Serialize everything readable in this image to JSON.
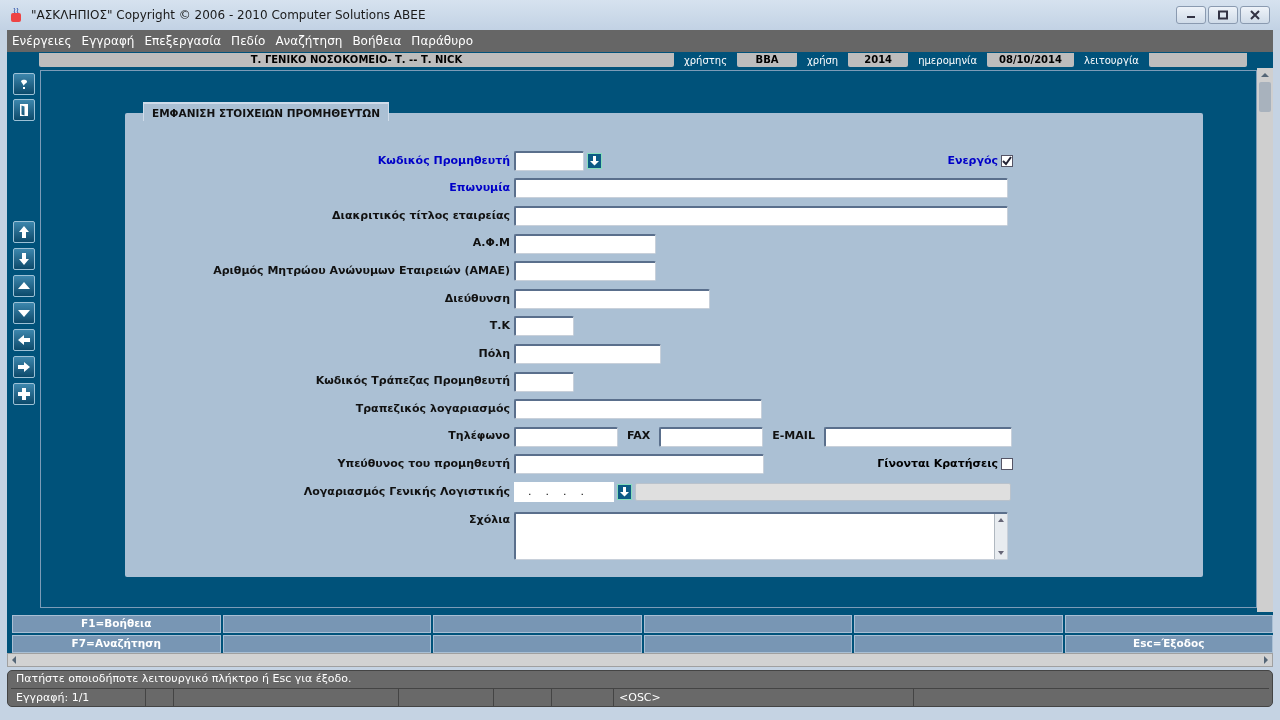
{
  "window": {
    "title": "\"ΑΣΚΛΗΠΙΟΣ\" Copyright © 2006 - 2010 Computer Solutions ABEE"
  },
  "menu": [
    "Ενέργειες",
    "Εγγραφή",
    "Επεξεργασία",
    "Πεδίο",
    "Αναζήτηση",
    "Βοήθεια",
    "Παράθυρο"
  ],
  "header": {
    "organization": "Τ. ΓΕΝΙΚΟ ΝΟΣΟΚΟΜΕΙΟ- Τ. -- Τ. ΝΙCK",
    "items": [
      {
        "label": "χρήστης",
        "value": "BBA"
      },
      {
        "label": "χρήση",
        "value": "2014"
      },
      {
        "label": "ημερομηνία",
        "value": "08/10/2014"
      },
      {
        "label": "λειτουργία"
      }
    ]
  },
  "form": {
    "title": "ΕΜΦΑΝΙΣΗ ΣΤΟΙΧΕΙΩΝ ΠΡΟΜΗΘΕΥΤΩΝ",
    "rows": [
      {
        "label": "Κωδικός Προμηθευτή",
        "required": true,
        "fields": [
          {
            "kind": "lookup"
          }
        ],
        "aside": {
          "label": "Ενεργός",
          "required": true,
          "checked": true
        }
      },
      {
        "label": "Επωνυμία",
        "required": true,
        "fields": [
          {
            "kind": "text"
          }
        ]
      },
      {
        "label": "Διακριτικός τίτλος εταιρείας",
        "required": false,
        "fields": [
          {
            "kind": "text"
          }
        ]
      },
      {
        "label": "Α.Φ.Μ",
        "required": false,
        "fields": [
          {
            "kind": "text"
          }
        ]
      },
      {
        "label": "Αριθμός Μητρώου Ανώνυμων Εταιρειών (ΑΜΑΕ)",
        "required": false,
        "fields": [
          {
            "kind": "text"
          }
        ]
      },
      {
        "label": "Διεύθυνση",
        "required": false,
        "fields": [
          {
            "kind": "text"
          }
        ]
      },
      {
        "label": "Τ.Κ",
        "required": false,
        "fields": [
          {
            "kind": "text"
          }
        ]
      },
      {
        "label": "Πόλη",
        "required": false,
        "fields": [
          {
            "kind": "text"
          }
        ]
      },
      {
        "label": "Κωδικός Τράπεζας Προμηθευτή",
        "required": false,
        "fields": [
          {
            "kind": "text"
          }
        ]
      },
      {
        "label": "Τραπεζικός λογαριασμός",
        "required": false,
        "fields": [
          {
            "kind": "text"
          }
        ]
      },
      {
        "label": "Τηλέφωνο",
        "required": false,
        "fields": [
          {
            "kind": "text"
          },
          {
            "kind": "text",
            "label": "FAX"
          },
          {
            "kind": "text",
            "label": "E-MAIL"
          }
        ]
      },
      {
        "label": "Υπεύθυνος του προμηθευτή",
        "required": false,
        "fields": [
          {
            "kind": "text"
          }
        ],
        "aside": {
          "label": "Γίνονται Κρατήσεις",
          "required": false,
          "checked": false
        }
      },
      {
        "label": "Λογαριασμός Γενικής Λογιστικής",
        "required": false,
        "fields": [
          {
            "kind": "masked",
            "value": ".    .    .    ."
          },
          {
            "kind": "readonly"
          }
        ]
      },
      {
        "label": "Σχόλια",
        "required": false,
        "fields": [
          {
            "kind": "textarea"
          }
        ]
      }
    ]
  },
  "function_keys": [
    [
      {
        "kind": "key",
        "label": "F1=Βοήθεια"
      },
      {
        "kind": "blank"
      },
      {
        "kind": "blank"
      },
      {
        "kind": "blank"
      },
      {
        "kind": "blank"
      },
      {
        "kind": "blank"
      }
    ],
    [
      {
        "kind": "key",
        "label": "F7=Αναζήτηση"
      },
      {
        "kind": "blank"
      },
      {
        "kind": "blank"
      },
      {
        "kind": "blank"
      },
      {
        "kind": "blank"
      },
      {
        "kind": "key",
        "label": "Esc=Έξοδος"
      }
    ]
  ],
  "status_bar": {
    "message": "Πατήστε οποιοδήποτε λειτουργικό πλήκτρο ή Esc για έξοδο.",
    "record": "Εγγραφή: 1/1",
    "mode": "<OSC>"
  }
}
